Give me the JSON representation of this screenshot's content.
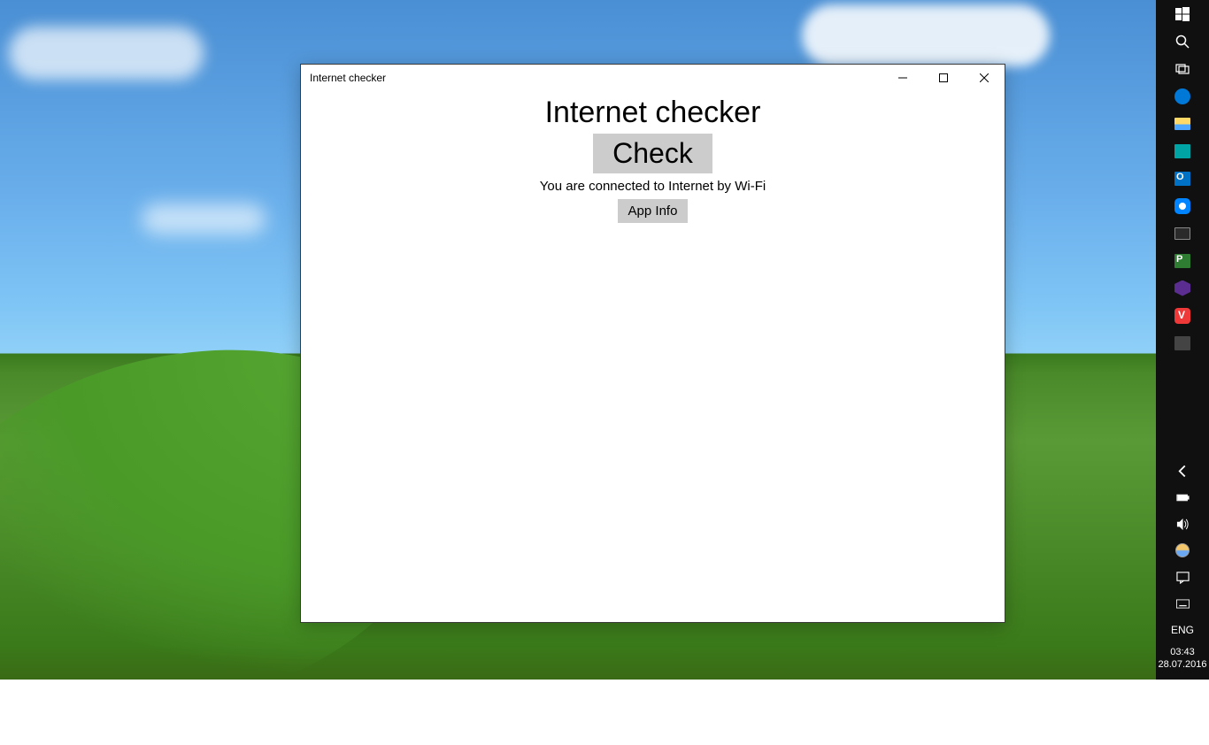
{
  "window": {
    "title": "Internet checker",
    "heading": "Internet checker",
    "check_label": "Check",
    "status_text": "You are connected to Internet by Wi-Fi",
    "appinfo_label": "App Info"
  },
  "taskbar": {
    "start": "Start",
    "search": "Search",
    "taskview": "Task View",
    "apps": [
      {
        "name": "edge",
        "label": "Microsoft Edge"
      },
      {
        "name": "file-explorer",
        "label": "File Explorer"
      },
      {
        "name": "app-teal",
        "label": "App"
      },
      {
        "name": "outlook",
        "label": "Outlook"
      },
      {
        "name": "messenger",
        "label": "Messenger"
      },
      {
        "name": "monitor",
        "label": "System Monitor"
      },
      {
        "name": "project",
        "label": "Project"
      },
      {
        "name": "visual-studio",
        "label": "Visual Studio"
      },
      {
        "name": "vivaldi",
        "label": "Vivaldi"
      },
      {
        "name": "settings-panel",
        "label": "Settings"
      }
    ]
  },
  "systray": {
    "expand": "Show hidden icons",
    "battery": "Battery",
    "volume": "Volume",
    "weather": "Weather",
    "notifications": "Notifications",
    "keyboard": "Touch keyboard",
    "language": "ENG",
    "time": "03:43",
    "date": "28.07.2016"
  }
}
